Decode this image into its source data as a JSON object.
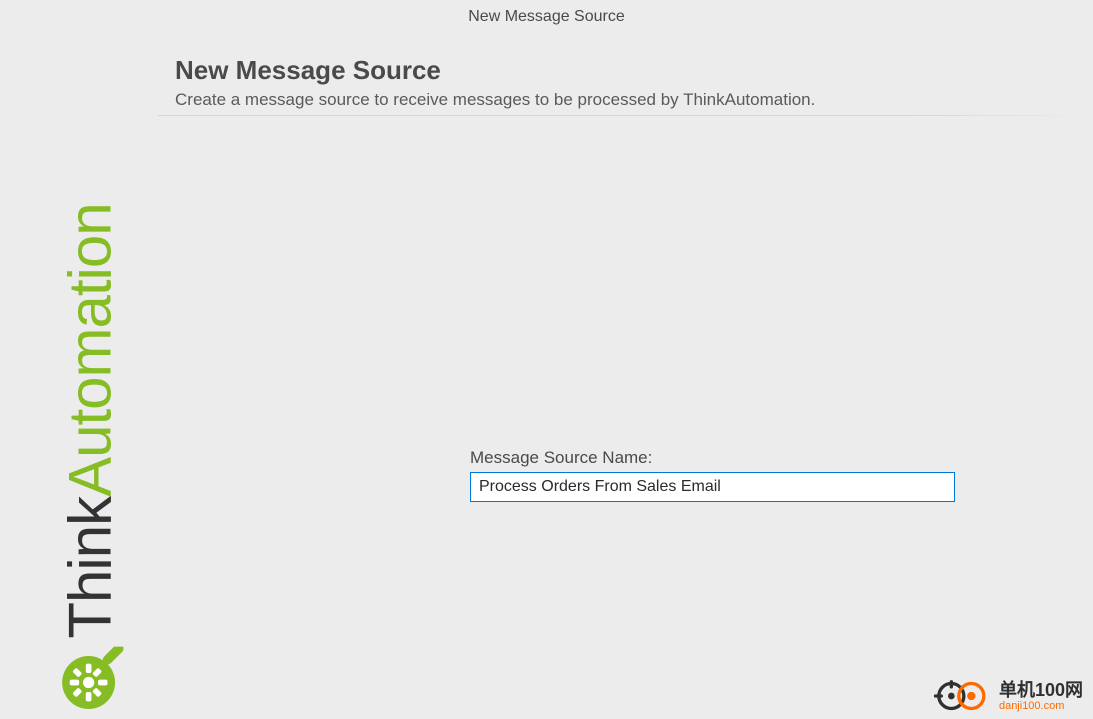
{
  "dialog_title": "New Message Source",
  "header": {
    "heading": "New Message Source",
    "subtitle": "Create a message source to receive messages to be processed by ThinkAutomation."
  },
  "brand": {
    "part1": "Think",
    "part2": "Automation",
    "accent_color": "#86bc24"
  },
  "form": {
    "name_label": "Message Source Name:",
    "name_value": "Process Orders From Sales Email"
  },
  "watermark": {
    "line1": "单机100网",
    "line2": "danji100.com"
  }
}
